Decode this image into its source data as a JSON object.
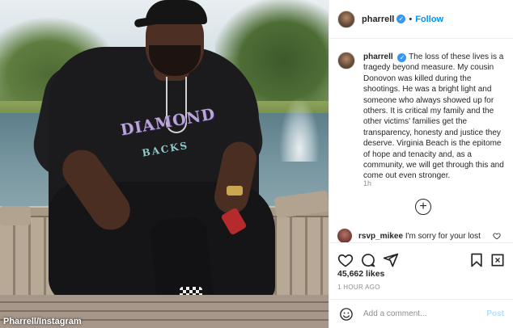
{
  "photo": {
    "credit": "Pharrell/Instagram",
    "jersey_text": "DIAMONDBACKS",
    "jersey_text_top": "DIAMOND",
    "jersey_text_bottom": "BACKS"
  },
  "post": {
    "username": "pharrell",
    "follow_label": "Follow",
    "separator": "•",
    "caption_user": "pharrell",
    "caption_text": "The loss of these lives is a tragedy beyond measure. My cousin Donovon was killed during the shootings. He was a bright light and someone who always showed up for others. It is critical my family and the other victims' families get the transparency, honesty and justice they deserve. Virginia Beach is the epitome of hope and tenacity and, as a community, we will get through this and come out even stronger.",
    "caption_time": "1h",
    "load_more_symbol": "+",
    "comment_user": "rsvp_mikee",
    "comment_text": "I'm sorry for your lost",
    "likes": "45,662 likes",
    "time_ago": "1 HOUR AGO",
    "add_comment_placeholder": "Add a comment...",
    "post_label": "Post"
  },
  "colors": {
    "link_blue": "#0095f6",
    "verified_blue": "#3897f0",
    "post_disabled": "#b2dffc",
    "muted_text": "#8e8e8e"
  },
  "icons": [
    "verified-badge-icon",
    "heart-icon",
    "comment-icon",
    "share-icon",
    "bookmark-icon",
    "emoji-icon",
    "plus-circle-icon"
  ]
}
